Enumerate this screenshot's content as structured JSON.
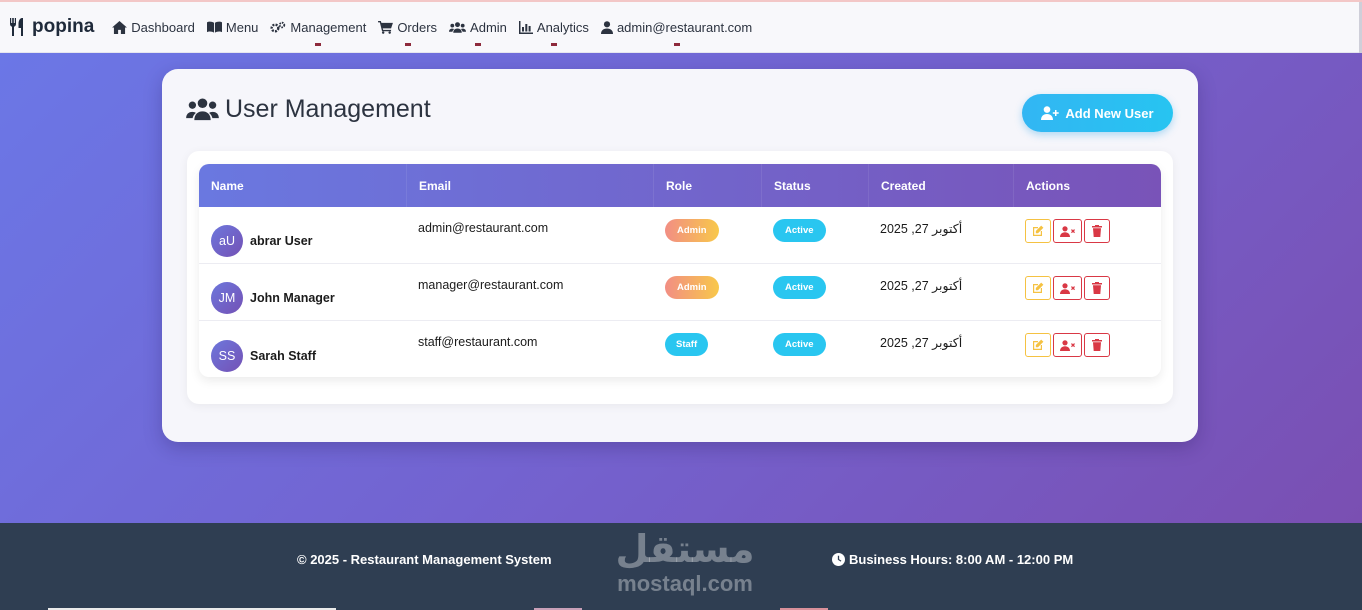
{
  "brand": {
    "name": "popina",
    "icon": "utensils-icon"
  },
  "nav": [
    {
      "label": "Dashboard",
      "icon": "home-icon",
      "marked": false
    },
    {
      "label": "Menu",
      "icon": "book-icon",
      "marked": false
    },
    {
      "label": "Management",
      "icon": "gears-icon",
      "marked": true
    },
    {
      "label": "Orders",
      "icon": "cart-icon",
      "marked": true
    },
    {
      "label": "Admin",
      "icon": "users-icon",
      "marked": true
    },
    {
      "label": "Analytics",
      "icon": "chart-icon",
      "marked": true
    },
    {
      "label": "admin@restaurant.com",
      "icon": "user-icon",
      "marked": true
    }
  ],
  "page": {
    "title": "User Management",
    "add_button": "Add New User"
  },
  "table": {
    "headers": [
      "Name",
      "Email",
      "Role",
      "Status",
      "Created",
      "Actions"
    ],
    "rows": [
      {
        "initials": "aU",
        "name": "abrar User",
        "email": "admin@restaurant.com",
        "role": "Admin",
        "status": "Active",
        "created": "أكتوبر 27, 2025"
      },
      {
        "initials": "JM",
        "name": "John Manager",
        "email": "manager@restaurant.com",
        "role": "Admin",
        "status": "Active",
        "created": "أكتوبر 27, 2025"
      },
      {
        "initials": "SS",
        "name": "Sarah Staff",
        "email": "staff@restaurant.com",
        "role": "Staff",
        "status": "Active",
        "created": "أكتوبر 27, 2025"
      }
    ]
  },
  "footer": {
    "copyright": "© 2025 - Restaurant Management System",
    "hours": "Business Hours: 8:00 AM - 12:00 PM",
    "watermark_ar": "مستقل",
    "watermark_en": "mostaql.com"
  },
  "colors": {
    "accent": "#6b77e6",
    "accent_end": "#7a4fb2",
    "info": "#29c6f0",
    "warning": "#f5c242",
    "danger": "#d93845",
    "footer_bg": "#2f3e52"
  }
}
